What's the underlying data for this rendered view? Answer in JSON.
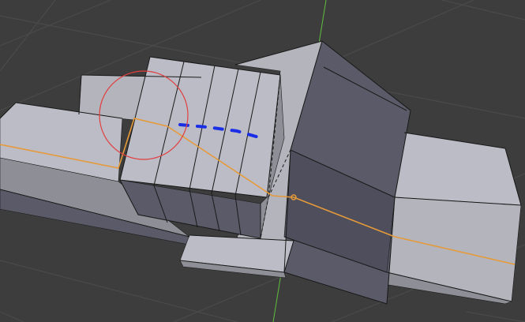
{
  "viewport": {
    "background_color": "#3d3d3d",
    "grid_color": "#4a4a4a",
    "axis_y_color": "#5fbf3f",
    "axis_x_color": "#c04040",
    "face_light": "#b4b4bc",
    "face_top": "#bcbcc6",
    "face_side": "#8e8e96",
    "face_dark": "#5a5a68",
    "face_darker": "#4e4e5c",
    "edge_color": "#1a1a1a",
    "seam_color": "#e69a3a",
    "loop_cut_color": "#1a2ee6",
    "brush_circle_color": "#e04040",
    "pivot_color": "#e69a3a"
  }
}
